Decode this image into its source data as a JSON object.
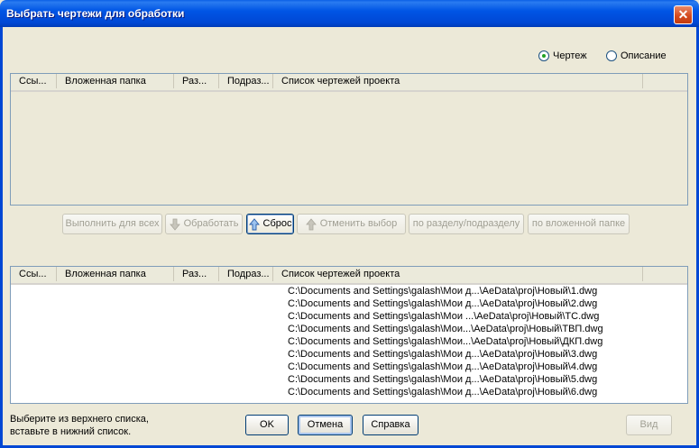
{
  "window": {
    "title": "Выбрать чертежи для обработки",
    "close": "✕"
  },
  "mode": {
    "options": [
      {
        "label": "Чертеж",
        "checked": true
      },
      {
        "label": "Описание",
        "checked": false
      }
    ]
  },
  "columns": [
    "Ссы...",
    "Вложенная папка",
    "Раз...",
    "Подраз...",
    "Список чертежей проекта"
  ],
  "toolbar": {
    "run_all": "Выполнить для всех",
    "process": "Обработать",
    "reset": "Сброс",
    "cancel_selection": "Отменить выбор",
    "by_section": "по разделу/подразделу",
    "by_folder": "по вложенной папке"
  },
  "top_list": {
    "rows": []
  },
  "bottom_list": {
    "rows": [
      "C:\\Documents and Settings\\galash\\Мои д...\\AeData\\proj\\Новый\\1.dwg",
      "C:\\Documents and Settings\\galash\\Мои д...\\AeData\\proj\\Новый\\2.dwg",
      "C:\\Documents and Settings\\galash\\Мои ...\\AeData\\proj\\Новый\\ТС.dwg",
      "C:\\Documents and Settings\\galash\\Мои...\\AeData\\proj\\Новый\\ТВП.dwg",
      "C:\\Documents and Settings\\galash\\Мои...\\AeData\\proj\\Новый\\ДКП.dwg",
      "C:\\Documents and Settings\\galash\\Мои д...\\AeData\\proj\\Новый\\3.dwg",
      "C:\\Documents and Settings\\galash\\Мои д...\\AeData\\proj\\Новый\\4.dwg",
      "C:\\Documents and Settings\\galash\\Мои д...\\AeData\\proj\\Новый\\5.dwg",
      "C:\\Documents and Settings\\galash\\Мои д...\\AeData\\proj\\Новый\\6.dwg"
    ]
  },
  "footer": {
    "hint_line1": "Выберите из верхнего списка,",
    "hint_line2": "вставьте в нижний список.",
    "ok": "OK",
    "cancel": "Отмена",
    "help": "Справка",
    "view": "Вид"
  },
  "colors": {
    "titlebar": "#0055e5",
    "face": "#ece9d8",
    "close": "#d54b1f"
  }
}
